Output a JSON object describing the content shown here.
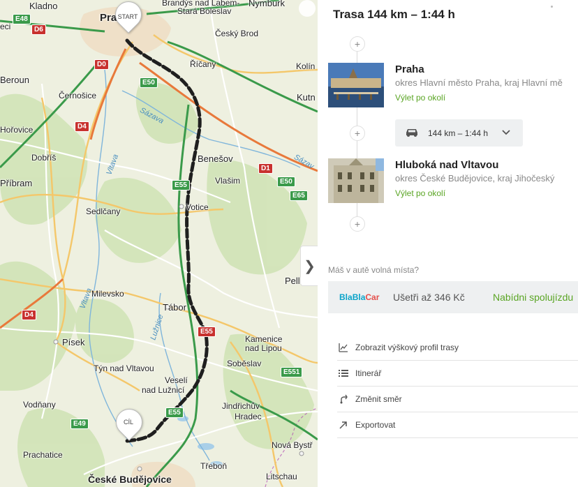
{
  "map": {
    "places": [
      "Kladno",
      "Praha",
      "Brandýs nad Labem-",
      "Stará Boleslav",
      "Nymburk",
      "Český Brod",
      "Říčany",
      "Kolín",
      "Beroun",
      "Černošice",
      "Kutn",
      "Hořovice",
      "Dobříš",
      "Benešov",
      "Vlašim",
      "Příbram",
      "Votice",
      "Sedlčany",
      "Pell",
      "Milevsko",
      "Tábor",
      "Písek",
      "Kamenice",
      "nad Lipou",
      "Soběslav",
      "Týn nad Vltavou",
      "Veselí",
      "nad Lužnicí",
      "Jindřichův",
      "Hradec",
      "Vodňany",
      "Nová Bystř",
      "Prachatice",
      "Třeboň",
      "České Budějovice",
      "Litschau",
      "Sázava",
      "Vltava",
      "Lužnice",
      "Sázav"
    ],
    "shields": {
      "e48": "E48",
      "d6": "D6",
      "d0": "D0",
      "e50a": "E50",
      "d4a": "D4",
      "d1": "D1",
      "e55a": "E55",
      "e50b": "E50",
      "e65": "E65",
      "d4b": "D4",
      "e55b": "E55",
      "e551": "E551",
      "e49": "E49",
      "e55c": "E55",
      "eci": "eci"
    },
    "start_label": "START",
    "end_label": "CÍL",
    "toggle": "❯"
  },
  "panel": {
    "title": "Trasa 144 km – 1:44 h",
    "waypoints": [
      {
        "name": "Praha",
        "sub": "okres Hlavní město Praha, kraj Hlavní mě",
        "link": "Výlet po okolí"
      },
      {
        "name": "Hluboká nad Vltavou",
        "sub": "okres České Budějovice, kraj Jihočeský",
        "link": "Výlet po okolí"
      }
    ],
    "segment": "144 km – 1:44 h",
    "plus": "+",
    "seats_question": "Máš v autě volná místa?",
    "blablacar": {
      "logo_a": "Bla",
      "logo_b": "Bla",
      "logo_c": "Car",
      "save": "Ušetři až 346 Kč",
      "offer": "Nabídni spolujízdu"
    },
    "actions": [
      "Zobrazit výškový profil trasy",
      "Itinerář",
      "Změnit směr",
      "Exportovat"
    ],
    "colors": {
      "accent": "#5aa524",
      "route": "#222222",
      "motorway": "#e8a33b"
    }
  }
}
